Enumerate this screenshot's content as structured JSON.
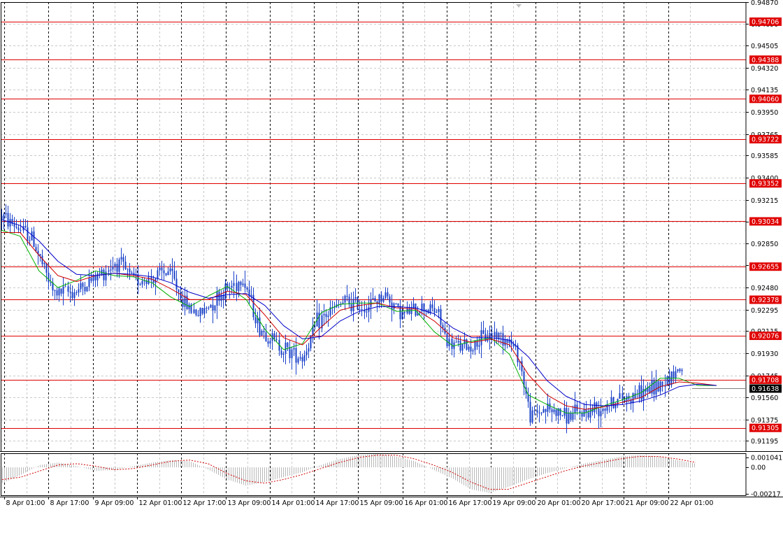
{
  "chart_data": [
    {
      "type": "candlestick",
      "title": "",
      "y_axis": {
        "ylim": [
          0.9111,
          0.9487
        ],
        "tick_labels": [
          "0.94870",
          "0.94690",
          "0.94505",
          "0.94320",
          "0.94135",
          "0.93950",
          "0.93765",
          "0.93585",
          "0.93400",
          "0.93215",
          "0.93030",
          "0.92850",
          "0.92665",
          "0.92480",
          "0.92295",
          "0.92115",
          "0.91930",
          "0.91745",
          "0.91560",
          "0.91375",
          "0.91195"
        ]
      },
      "x_axis": {
        "tick_labels": [
          "8 Apr 01:00",
          "8 Apr 17:00",
          "9 Apr 09:00",
          "12 Apr 01:00",
          "12 Apr 17:00",
          "13 Apr 09:00",
          "14 Apr 01:00",
          "14 Apr 17:00",
          "15 Apr 09:00",
          "16 Apr 01:00",
          "16 Apr 17:00",
          "19 Apr 09:00",
          "20 Apr 01:00",
          "20 Apr 17:00",
          "21 Apr 09:00",
          "22 Apr 01:00"
        ]
      },
      "grid": true,
      "levels": [
        {
          "label": "0.94706",
          "value": 0.94706
        },
        {
          "label": "0.94388",
          "value": 0.94388
        },
        {
          "label": "0.94060",
          "value": 0.9406
        },
        {
          "label": "0.93722",
          "value": 0.93722
        },
        {
          "label": "0.93352",
          "value": 0.93352
        },
        {
          "label": "0.93034",
          "value": 0.93034
        },
        {
          "label": "0.92655",
          "value": 0.92655
        },
        {
          "label": "0.92378",
          "value": 0.92378
        },
        {
          "label": "0.92076",
          "value": 0.92076
        },
        {
          "label": "0.91708",
          "value": 0.91708
        },
        {
          "label": "0.91305",
          "value": 0.91305
        }
      ],
      "current_price": {
        "label": "0.91638",
        "value": 0.91638
      },
      "price_path": [
        [
          0,
          0.9308
        ],
        [
          0.04,
          0.929
        ],
        [
          0.07,
          0.9243
        ],
        [
          0.1,
          0.9245
        ],
        [
          0.13,
          0.9258
        ],
        [
          0.155,
          0.927
        ],
        [
          0.175,
          0.9255
        ],
        [
          0.2,
          0.9255
        ],
        [
          0.225,
          0.9262
        ],
        [
          0.245,
          0.9235
        ],
        [
          0.265,
          0.9225
        ],
        [
          0.29,
          0.924
        ],
        [
          0.31,
          0.925
        ],
        [
          0.325,
          0.9256
        ],
        [
          0.345,
          0.9215
        ],
        [
          0.375,
          0.9198
        ],
        [
          0.405,
          0.919
        ],
        [
          0.425,
          0.922
        ],
        [
          0.46,
          0.9236
        ],
        [
          0.49,
          0.9232
        ],
        [
          0.515,
          0.9242
        ],
        [
          0.54,
          0.9225
        ],
        [
          0.565,
          0.9232
        ],
        [
          0.585,
          0.9228
        ],
        [
          0.6,
          0.92
        ],
        [
          0.63,
          0.9198
        ],
        [
          0.66,
          0.921
        ],
        [
          0.68,
          0.9205
        ],
        [
          0.695,
          0.919
        ],
        [
          0.71,
          0.914
        ],
        [
          0.73,
          0.9147
        ],
        [
          0.76,
          0.914
        ],
        [
          0.79,
          0.9145
        ],
        [
          0.82,
          0.9152
        ],
        [
          0.85,
          0.9158
        ],
        [
          0.88,
          0.9165
        ],
        [
          0.91,
          0.918
        ],
        [
          0.935,
          0.9175
        ],
        [
          0.955,
          0.9162
        ],
        [
          0.975,
          0.9166
        ]
      ],
      "series": [
        {
          "name": "MA fast",
          "color": "#00b000",
          "values": [
            0.9296,
            0.9291,
            0.9262,
            0.9248,
            0.9254,
            0.9262,
            0.9258,
            0.9257,
            0.9252,
            0.924,
            0.9232,
            0.9241,
            0.9249,
            0.9238,
            0.9213,
            0.9196,
            0.9201,
            0.9227,
            0.9234,
            0.9235,
            0.9235,
            0.9228,
            0.9229,
            0.9211,
            0.9199,
            0.9203,
            0.9206,
            0.9192,
            0.9158,
            0.915,
            0.9143,
            0.9143,
            0.9149,
            0.9154,
            0.916,
            0.9172,
            0.9172,
            0.9166,
            0.9166
          ]
        },
        {
          "name": "MA mid",
          "color": "#d00000",
          "values": [
            0.9294,
            0.9294,
            0.9275,
            0.9258,
            0.9253,
            0.9258,
            0.926,
            0.9258,
            0.9255,
            0.9247,
            0.9238,
            0.9238,
            0.9245,
            0.9242,
            0.9225,
            0.9206,
            0.92,
            0.9215,
            0.9229,
            0.9233,
            0.9235,
            0.9231,
            0.923,
            0.922,
            0.9206,
            0.9202,
            0.9205,
            0.92,
            0.9175,
            0.9158,
            0.9149,
            0.9146,
            0.9148,
            0.9152,
            0.9156,
            0.9165,
            0.9169,
            0.9168,
            0.9166
          ]
        },
        {
          "name": "MA slow",
          "color": "#0000c8",
          "values": [
            0.9305,
            0.93,
            0.9287,
            0.927,
            0.9259,
            0.9258,
            0.926,
            0.9259,
            0.9257,
            0.9252,
            0.9244,
            0.9239,
            0.9242,
            0.9243,
            0.9233,
            0.9216,
            0.9205,
            0.9207,
            0.922,
            0.9228,
            0.9232,
            0.9232,
            0.9231,
            0.9226,
            0.9214,
            0.9206,
            0.9206,
            0.9204,
            0.919,
            0.917,
            0.9157,
            0.915,
            0.9149,
            0.915,
            0.9153,
            0.9158,
            0.9165,
            0.9167,
            0.9166
          ]
        }
      ]
    },
    {
      "type": "histogram",
      "title": "",
      "y_axis": {
        "tick_labels": [
          "0.001041",
          "0.00",
          "-0.00217"
        ],
        "ylim": [
          -0.00217,
          0.001041
        ]
      },
      "values": [
        -0.0013,
        -0.0006,
        0.0002,
        0.0004,
        0.0001,
        -0.0003,
        -0.0002,
        0.0001,
        0.0004,
        0.0006,
        0.0005,
        -0.0002,
        -0.001,
        -0.0015,
        -0.0012,
        -0.0008,
        -0.0004,
        0.0002,
        0.0007,
        0.001,
        0.0011,
        0.0009,
        0.0005,
        -0.0002,
        -0.0009,
        -0.0018,
        -0.0021,
        -0.0016,
        -0.001,
        -0.0005,
        -0.0001,
        0.0003,
        0.0006,
        0.0009,
        0.001,
        0.0009,
        0.0006,
        0.0003
      ],
      "signal": [
        -0.001,
        -0.0008,
        -0.0003,
        0.0002,
        0.0003,
        0.0001,
        -0.0002,
        -0.0001,
        0.0002,
        0.0005,
        0.0006,
        0.0003,
        -0.0005,
        -0.0011,
        -0.0013,
        -0.001,
        -0.0006,
        -0.0001,
        0.0004,
        0.0008,
        0.001,
        0.001,
        0.0007,
        0.0002,
        -0.0004,
        -0.0012,
        -0.0018,
        -0.0018,
        -0.0013,
        -0.0008,
        -0.0003,
        0.0001,
        0.0004,
        0.0007,
        0.0009,
        0.0009,
        0.0007,
        0.0004
      ],
      "colors": {
        "bars": "#b8b8b8",
        "signal": "#d00000"
      }
    }
  ],
  "colors": {
    "background": "#ffffff",
    "grid": "#c8c8c8",
    "separator": "#000000",
    "level_line": "#e00000",
    "level_tag": "#e00000",
    "price_tag": "#000000",
    "candle_up": "#1840c8",
    "candle_down": "#1840c8",
    "text": "#000000"
  }
}
